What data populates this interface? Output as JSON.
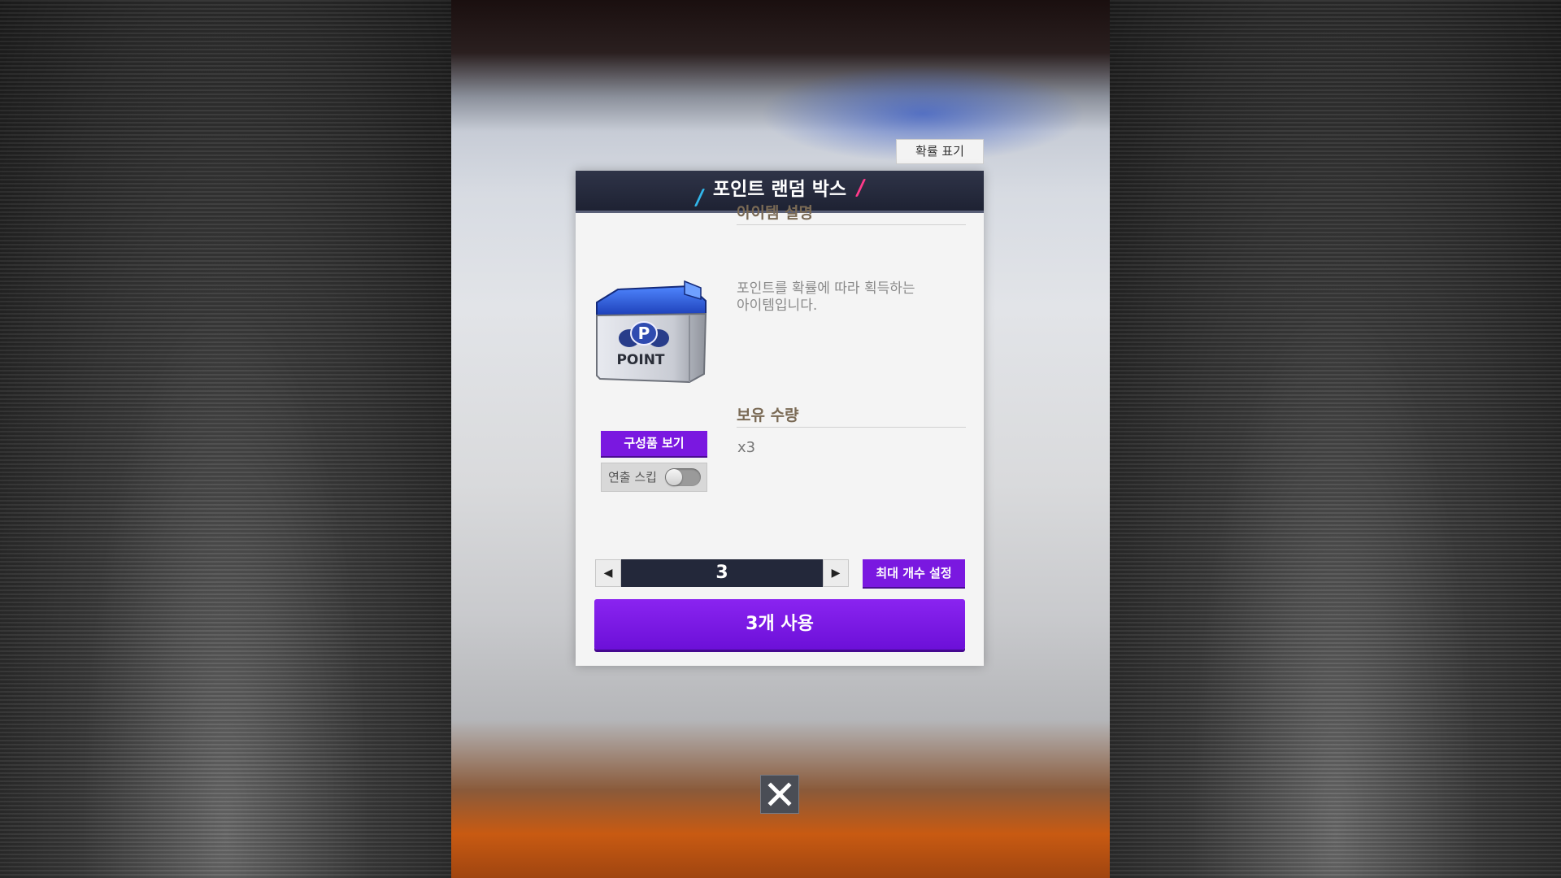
{
  "top_button": {
    "label": "확률 표기"
  },
  "modal": {
    "title": "포인트 랜덤 박스",
    "item_image": {
      "icon": "point-box-icon",
      "label": "POINT",
      "badge_letter": "P"
    },
    "description": {
      "heading": "아이템 설명",
      "text_line1": "포인트를 확률에 따라 획득하는",
      "text_line2": "아이템입니다."
    },
    "holdings": {
      "heading": "보유 수량",
      "value": "x3"
    },
    "composition_button": {
      "label": "구성품 보기"
    },
    "skip_toggle": {
      "label": "연출 스킵",
      "on": false
    },
    "quantity": {
      "value": "3",
      "decrease_icon": "triangle-left-icon",
      "increase_icon": "triangle-right-icon"
    },
    "max_button": {
      "label": "최대 개수 설정"
    },
    "use_button": {
      "label": "3개 사용"
    }
  },
  "close_button": {
    "icon": "close-icon"
  },
  "colors": {
    "accent_purple": "#7a18e0",
    "header_navy": "#23283a",
    "title_slash_blue": "#32b6ea",
    "title_slash_pink": "#ff3a8a"
  }
}
